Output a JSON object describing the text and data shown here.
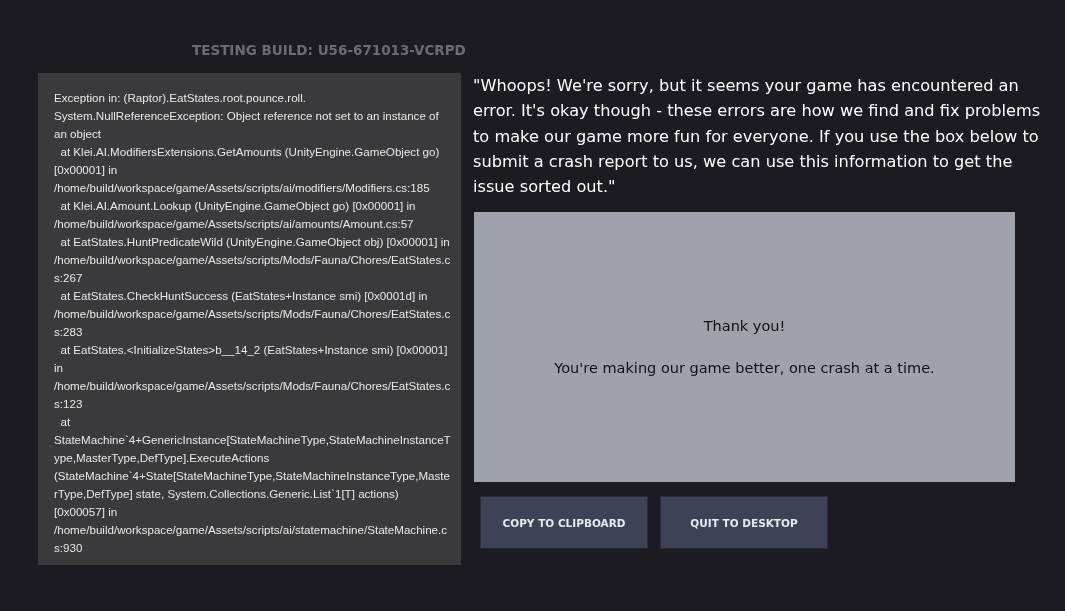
{
  "build_label": "TESTING BUILD: U56-671013-VCRPD",
  "stack_trace": "Exception in: (Raptor).EatStates.root.pounce.roll.\nSystem.NullReferenceException: Object reference not set to an instance of an object\n  at Klei.AI.ModifiersExtensions.GetAmounts (UnityEngine.GameObject go) [0x00001] in /home/build/workspace/game/Assets/scripts/ai/modifiers/Modifiers.cs:185\n  at Klei.AI.Amount.Lookup (UnityEngine.GameObject go) [0x00001] in /home/build/workspace/game/Assets/scripts/ai/amounts/Amount.cs:57\n  at EatStates.HuntPredicateWild (UnityEngine.GameObject obj) [0x00001] in /home/build/workspace/game/Assets/scripts/Mods/Fauna/Chores/EatStates.cs:267\n  at EatStates.CheckHuntSuccess (EatStates+Instance smi) [0x0001d] in /home/build/workspace/game/Assets/scripts/Mods/Fauna/Chores/EatStates.cs:283\n  at EatStates.<InitializeStates>b__14_2 (EatStates+Instance smi) [0x00001] in /home/build/workspace/game/Assets/scripts/Mods/Fauna/Chores/EatStates.cs:123\n  at StateMachine`4+GenericInstance[StateMachineType,StateMachineInstanceType,MasterType,DefType].ExecuteActions (StateMachine`4+State[StateMachineType,StateMachineInstanceType,MasterType,DefType] state, System.Collections.Generic.List`1[T] actions) [0x00057] in /home/build/workspace/game/Assets/scripts/ai/statemachine/StateMachine.cs:930",
  "apology": "\"Whoops! We're sorry, but it seems your game has encountered an error. It's okay though - these errors are how we find and fix problems to make our game more fun for everyone. If you use the box below to submit a crash report to us, we can use this information to get the issue sorted out.\"",
  "report_panel": {
    "lines": [
      "Thank you!",
      "You're making our game better, one crash at a time."
    ]
  },
  "buttons": [
    "COPY TO CLIPBOARD",
    "QUIT TO DESKTOP"
  ]
}
